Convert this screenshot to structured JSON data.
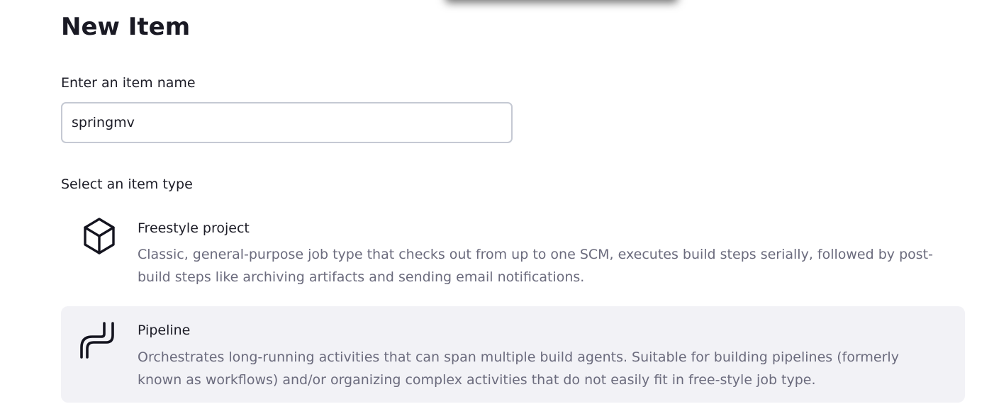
{
  "page": {
    "title": "New Item"
  },
  "name_field": {
    "label": "Enter an item name",
    "value": "springmv"
  },
  "item_types": {
    "label": "Select an item type",
    "items": [
      {
        "title": "Freestyle project",
        "description": "Classic, general-purpose job type that checks out from up to one SCM, executes build steps serially, followed by post-build steps like archiving artifacts and sending email notifications.",
        "icon": "cube-icon"
      },
      {
        "title": "Pipeline",
        "description": "Orchestrates long-running activities that can span multiple build agents. Suitable for building pipelines (formerly known as workflows) and/or organizing complex activities that do not easily fit in free-style job type.",
        "icon": "pipeline-icon"
      }
    ]
  },
  "colors": {
    "text": "#1d1d27",
    "muted_text": "#6b6b7d",
    "input_border": "#c5c9d3",
    "hover_background": "#f2f2f6"
  }
}
